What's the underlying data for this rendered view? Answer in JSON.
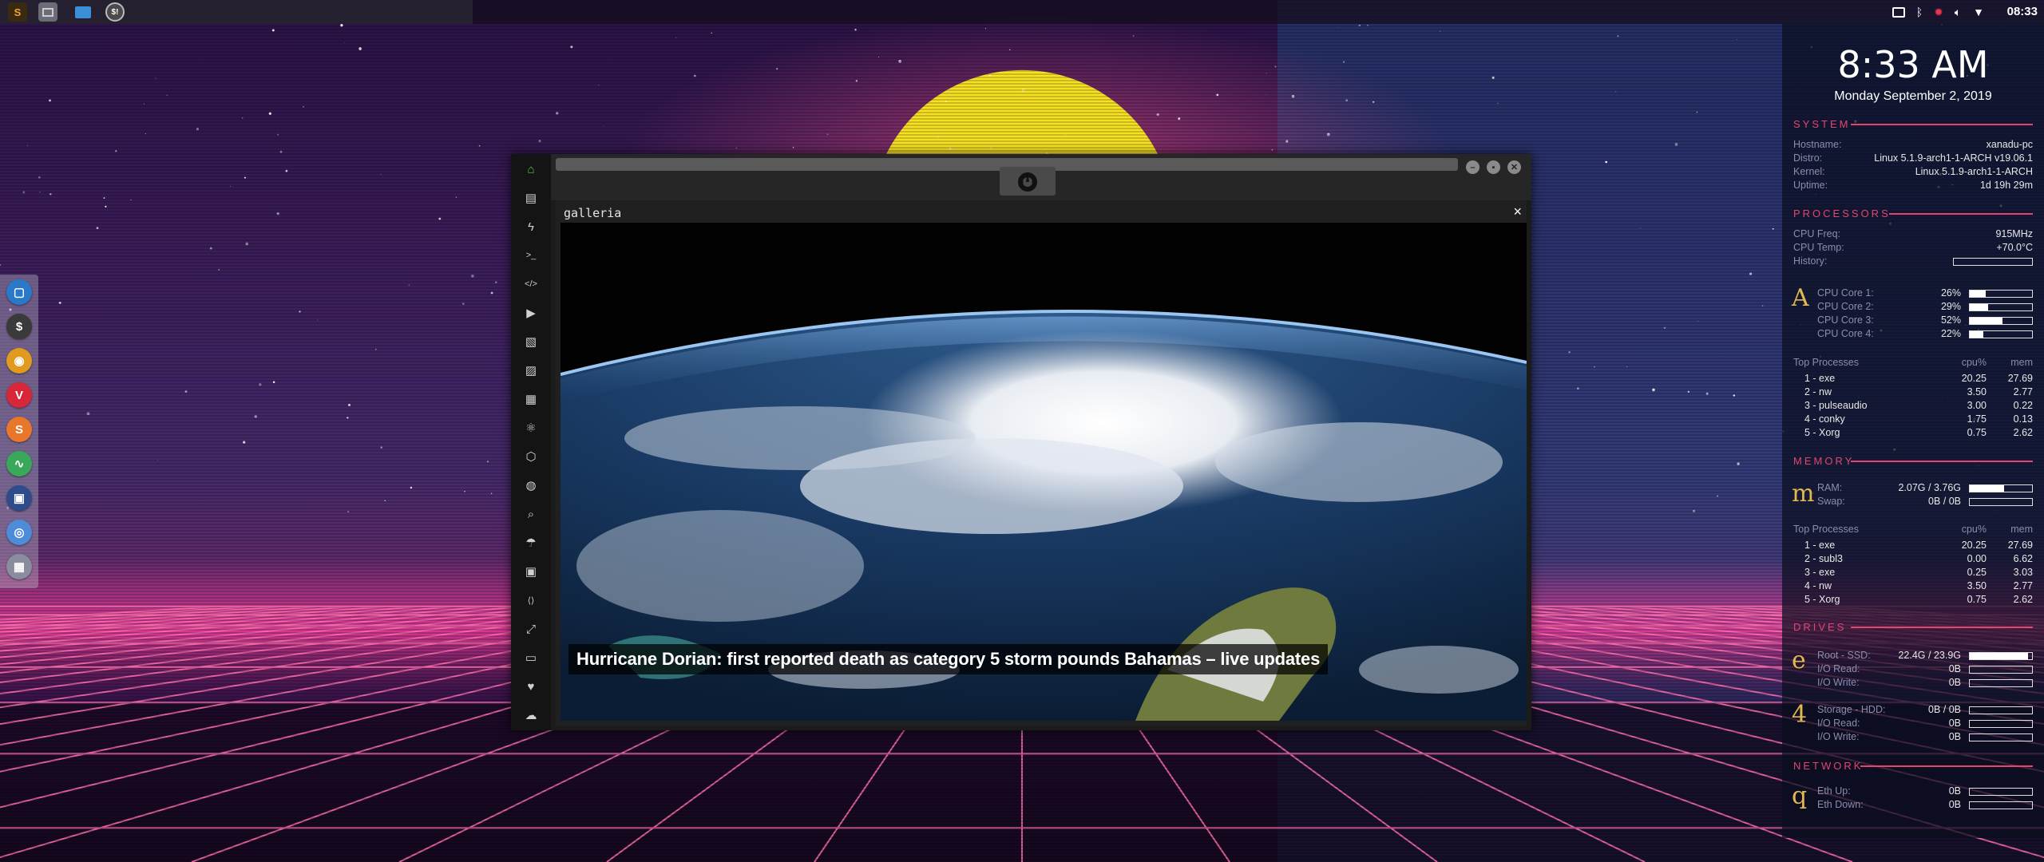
{
  "top_panel": {
    "launchers": [
      {
        "name": "sublime-launcher",
        "glyph": "S",
        "color": "#e8892b"
      },
      {
        "name": "window-switcher",
        "glyph": "",
        "color": "#7d7d88"
      },
      {
        "name": "files-launcher",
        "glyph": "",
        "color": "#3a8fd8"
      },
      {
        "name": "scripts-launcher",
        "glyph": "$!",
        "color": "#555"
      }
    ],
    "clock": "08:33"
  },
  "dock": {
    "items": [
      {
        "name": "dock-files",
        "glyph": "▢",
        "color": "#2a78c8"
      },
      {
        "name": "dock-terminal",
        "glyph": "$",
        "color": "#3a3a3a"
      },
      {
        "name": "dock-ubuntu",
        "glyph": "◉",
        "color": "#e09a1e"
      },
      {
        "name": "dock-vivaldi",
        "glyph": "V",
        "color": "#d8263a"
      },
      {
        "name": "dock-sublime",
        "glyph": "S",
        "color": "#e8762b"
      },
      {
        "name": "dock-monitor",
        "glyph": "∿",
        "color": "#3aa85a"
      },
      {
        "name": "dock-display",
        "glyph": "▣",
        "color": "#2c4c8c"
      },
      {
        "name": "dock-chromium",
        "glyph": "◎",
        "color": "#4c8cd8"
      },
      {
        "name": "dock-workspaces",
        "glyph": "▦",
        "color": "#8a8ca0"
      }
    ]
  },
  "app": {
    "viewer_title": "galleria",
    "caption": "Hurricane Dorian: first reported death as category 5 storm pounds Bahamas – live updates",
    "sidebar_icons": [
      "home-icon",
      "document-icon",
      "bolt-icon",
      "terminal-icon",
      "code-icon",
      "play-icon",
      "gallery-icon",
      "image-icon",
      "news-icon",
      "react-icon",
      "graphql-icon",
      "globe-icon",
      "search-icon",
      "umbrella-icon",
      "contact-icon",
      "api-icon",
      "expand-icon",
      "youtube-icon",
      "heart-icon",
      "cloud-icon"
    ]
  },
  "conky": {
    "time": "8:33 AM",
    "date": "Monday September  2, 2019",
    "system": {
      "heading": "SYSTEM",
      "rows": [
        {
          "key": "Hostname:",
          "value": "xanadu-pc"
        },
        {
          "key": "Distro:",
          "value": "Linux 5.1.9-arch1-1-ARCH v19.06.1"
        },
        {
          "key": "Kernel:",
          "value": "Linux 5.1.9-arch1-1-ARCH"
        },
        {
          "key": "Uptime:",
          "value": "1d 19h 29m"
        }
      ]
    },
    "processors": {
      "heading": "PROCESSORS",
      "rows": [
        {
          "key": "CPU Freq:",
          "value": "915MHz"
        },
        {
          "key": "CPU Temp:",
          "value": "+70.0°C"
        },
        {
          "key": "History:",
          "value": ""
        }
      ],
      "letter": "A",
      "cores": [
        {
          "key": "CPU Core 1:",
          "value": "26%",
          "fill": 0.26
        },
        {
          "key": "CPU Core 2:",
          "value": "29%",
          "fill": 0.29
        },
        {
          "key": "CPU Core 3:",
          "value": "52%",
          "fill": 0.52
        },
        {
          "key": "CPU Core 4:",
          "value": "22%",
          "fill": 0.22
        }
      ],
      "top_processes_label": "Top Processes",
      "cpu_label": "cpu%",
      "mem_label": "mem",
      "top_processes": [
        {
          "name": "1 - exe",
          "cpu": "20.25",
          "mem": "27.69"
        },
        {
          "name": "2 - nw",
          "cpu": "3.50",
          "mem": "2.77"
        },
        {
          "name": "3 - pulseaudio",
          "cpu": "3.00",
          "mem": "0.22"
        },
        {
          "name": "4 - conky",
          "cpu": "1.75",
          "mem": "0.13"
        },
        {
          "name": "5 - Xorg",
          "cpu": "0.75",
          "mem": "2.62"
        }
      ]
    },
    "memory": {
      "heading": "MEMORY",
      "letter": "m",
      "rows": [
        {
          "key": "RAM:",
          "value": "2.07G / 3.76G",
          "fill": 0.55
        },
        {
          "key": "Swap:",
          "value": "0B / 0B",
          "fill": 0
        }
      ],
      "top_processes_label": "Top Processes",
      "cpu_label": "cpu%",
      "mem_label": "mem",
      "top_processes": [
        {
          "name": "1 - exe",
          "cpu": "20.25",
          "mem": "27.69"
        },
        {
          "name": "2 - subl3",
          "cpu": "0.00",
          "mem": "6.62"
        },
        {
          "name": "3 - exe",
          "cpu": "0.25",
          "mem": "3.03"
        },
        {
          "name": "4 - nw",
          "cpu": "3.50",
          "mem": "2.77"
        },
        {
          "name": "5 - Xorg",
          "cpu": "0.75",
          "mem": "2.62"
        }
      ]
    },
    "drives": {
      "heading": "DRIVES",
      "groups": [
        {
          "letter": "e",
          "rows": [
            {
              "key": "Root - SSD:",
              "value": "22.4G / 23.9G",
              "fill": 0.94
            },
            {
              "key": "I/O Read:",
              "value": "0B",
              "fill": 0
            },
            {
              "key": "I/O Write:",
              "value": "0B",
              "fill": 0
            }
          ]
        },
        {
          "letter": "4",
          "rows": [
            {
              "key": "Storage - HDD:",
              "value": "0B / 0B",
              "fill": 0
            },
            {
              "key": "I/O Read:",
              "value": "0B",
              "fill": 0
            },
            {
              "key": "I/O Write:",
              "value": "0B",
              "fill": 0
            }
          ]
        }
      ]
    },
    "network": {
      "heading": "NETWORK",
      "letter": "q",
      "rows": [
        {
          "key": "Eth Up:",
          "value": "0B",
          "fill": 0
        },
        {
          "key": "Eth Down:",
          "value": "0B",
          "fill": 0
        }
      ]
    }
  }
}
